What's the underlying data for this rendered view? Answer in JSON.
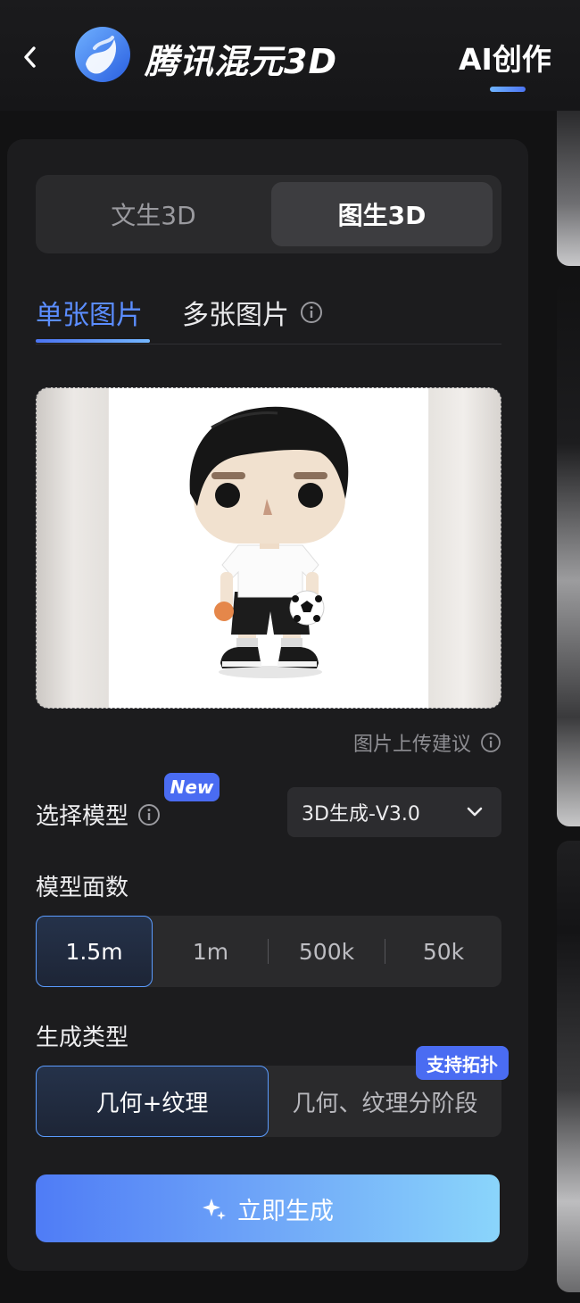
{
  "header": {
    "brand": "腾讯混元3D",
    "nav_active": "AI创作",
    "icons": {
      "back": "chevron-left-icon",
      "logo": "hunyuan-logo-icon"
    }
  },
  "mode_switch": {
    "text_to_3d": "文生3D",
    "image_to_3d": "图生3D",
    "selected": "图生3D"
  },
  "image_tabs": {
    "single": "单张图片",
    "multi": "多张图片",
    "selected": "单张图片"
  },
  "upload": {
    "tip": "图片上传建议"
  },
  "model_select": {
    "label": "选择模型",
    "badge": "New",
    "value": "3D生成-V3.0"
  },
  "face_count": {
    "label": "模型面数",
    "options": [
      "1.5m",
      "1m",
      "500k",
      "50k"
    ],
    "selected": "1.5m"
  },
  "gen_type": {
    "label": "生成类型",
    "options": [
      "几何+纹理",
      "几何、纹理分阶段"
    ],
    "selected": "几何+纹理",
    "badge": "支持拓扑"
  },
  "cta": {
    "label": "立即生成"
  },
  "colors": {
    "accent": "#5b8dff",
    "badge": "#4a6cf2",
    "panel": "#1c1c1e",
    "background": "#121213"
  }
}
